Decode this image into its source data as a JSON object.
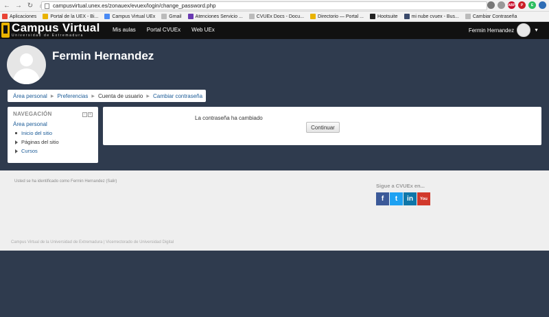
{
  "browser": {
    "url": "campusvirtual.unex.es/zonauex/evuex/login/change_password.php",
    "extensions": [
      {
        "icon": "key-icon",
        "color": "#777777",
        "label": ""
      },
      {
        "icon": "star-icon",
        "color": "#999999",
        "label": ""
      },
      {
        "icon": "abp-icon",
        "color": "#c70d2c",
        "label": "ABP"
      },
      {
        "icon": "pinterest-icon",
        "color": "#cb2027",
        "label": "P"
      },
      {
        "icon": "evernote-icon",
        "color": "#2dbe60",
        "label": "E"
      },
      {
        "icon": "extension-icon",
        "color": "#2f6db5",
        "label": ""
      }
    ],
    "bookmarks": [
      {
        "label": "Aplicaciones",
        "icon": "apps-icon",
        "color": "#e94335"
      },
      {
        "label": "Portal de la UEX - Bi...",
        "icon": "uex-icon",
        "color": "#e9b300"
      },
      {
        "label": "Campus Virtual UEx",
        "icon": "chrome-icon",
        "color": "#4a8af4"
      },
      {
        "label": "Gmail",
        "icon": "document-icon",
        "color": "#bbbbbb"
      },
      {
        "label": "Atenciones Servicio ...",
        "icon": "calendar-icon",
        "color": "#6a3ab2"
      },
      {
        "label": "CVUEx Docs - Docu...",
        "icon": "document-icon",
        "color": "#bbbbbb"
      },
      {
        "label": "Directorio — Portal ...",
        "icon": "uex-icon",
        "color": "#e9b300"
      },
      {
        "label": "Hootsuite",
        "icon": "owl-icon",
        "color": "#222222"
      },
      {
        "label": "mi nube cvuex - Bus...",
        "icon": "cloud-icon",
        "color": "#3a4a6b"
      },
      {
        "label": "Cambiar Contraseña",
        "icon": "document-icon",
        "color": "#bbbbbb"
      }
    ]
  },
  "site": {
    "logo_title": "Campus Virtual",
    "logo_subtitle": "Universidad de Extremadura",
    "nav": [
      "Mis aulas",
      "Portal CVUEx",
      "Web UEx"
    ],
    "user_name": "Fermin Hernandez"
  },
  "page": {
    "title": "Fermin Hernandez",
    "breadcrumb": [
      "Área personal",
      "Preferencias",
      "Cuenta de usuario",
      "Cambiar contraseña"
    ]
  },
  "navigation_block": {
    "heading": "NAVEGACIÓN",
    "home": "Área personal",
    "items": [
      "Inicio del sitio",
      "Páginas del sitio",
      "Cursos"
    ]
  },
  "main": {
    "message": "La contraseña ha cambiado",
    "continue_label": "Continuar"
  },
  "footer": {
    "login_info": "Usted se ha identificado como Fermin Hernandez (Salir)",
    "social_title": "Sigue a CVUEx en...",
    "social": [
      {
        "icon": "facebook-icon",
        "glyph": "f",
        "color": "#3b5998"
      },
      {
        "icon": "twitter-icon",
        "glyph": "t",
        "color": "#1da1f2"
      },
      {
        "icon": "linkedin-icon",
        "glyph": "in",
        "color": "#0e76a8"
      },
      {
        "icon": "youtube-icon",
        "glyph": "You",
        "color": "#d1392b"
      }
    ],
    "copyright": "Campus Virtual de la Universidad de Extremadura | Vicerrectorado de Universidad Digital"
  }
}
